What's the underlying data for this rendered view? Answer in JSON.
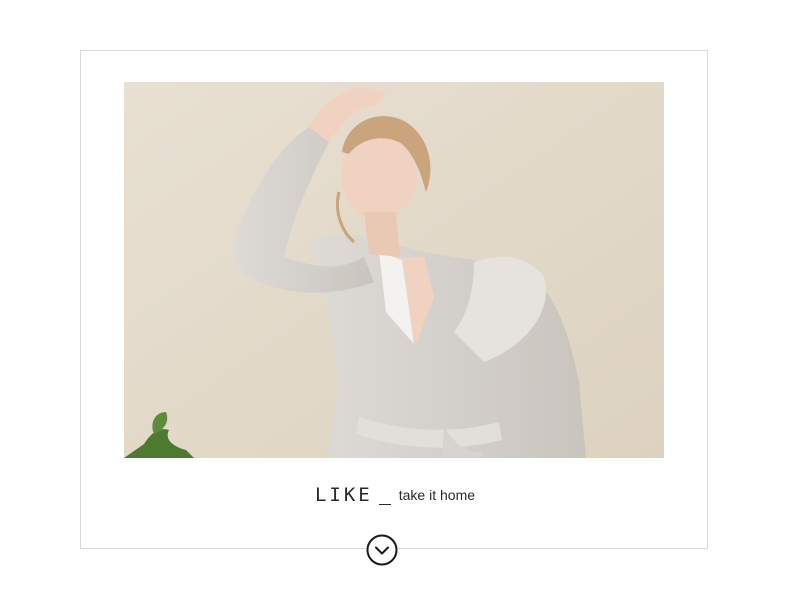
{
  "caption": {
    "title": "LIKE",
    "subtitle": "take it home"
  },
  "photo": {
    "alt": "woman-in-grey-hooded-robe",
    "colors": {
      "backdrop": "#e3d9c9",
      "robe": "#d3cfca",
      "skin": "#efd3c0",
      "hair": "#c9a47c",
      "plant": "#4d7a2e"
    }
  },
  "icons": {
    "down": "chevron-down-circle-icon"
  },
  "colors": {
    "frame_border": "#d9d9d9",
    "text": "#2a2a2a"
  }
}
